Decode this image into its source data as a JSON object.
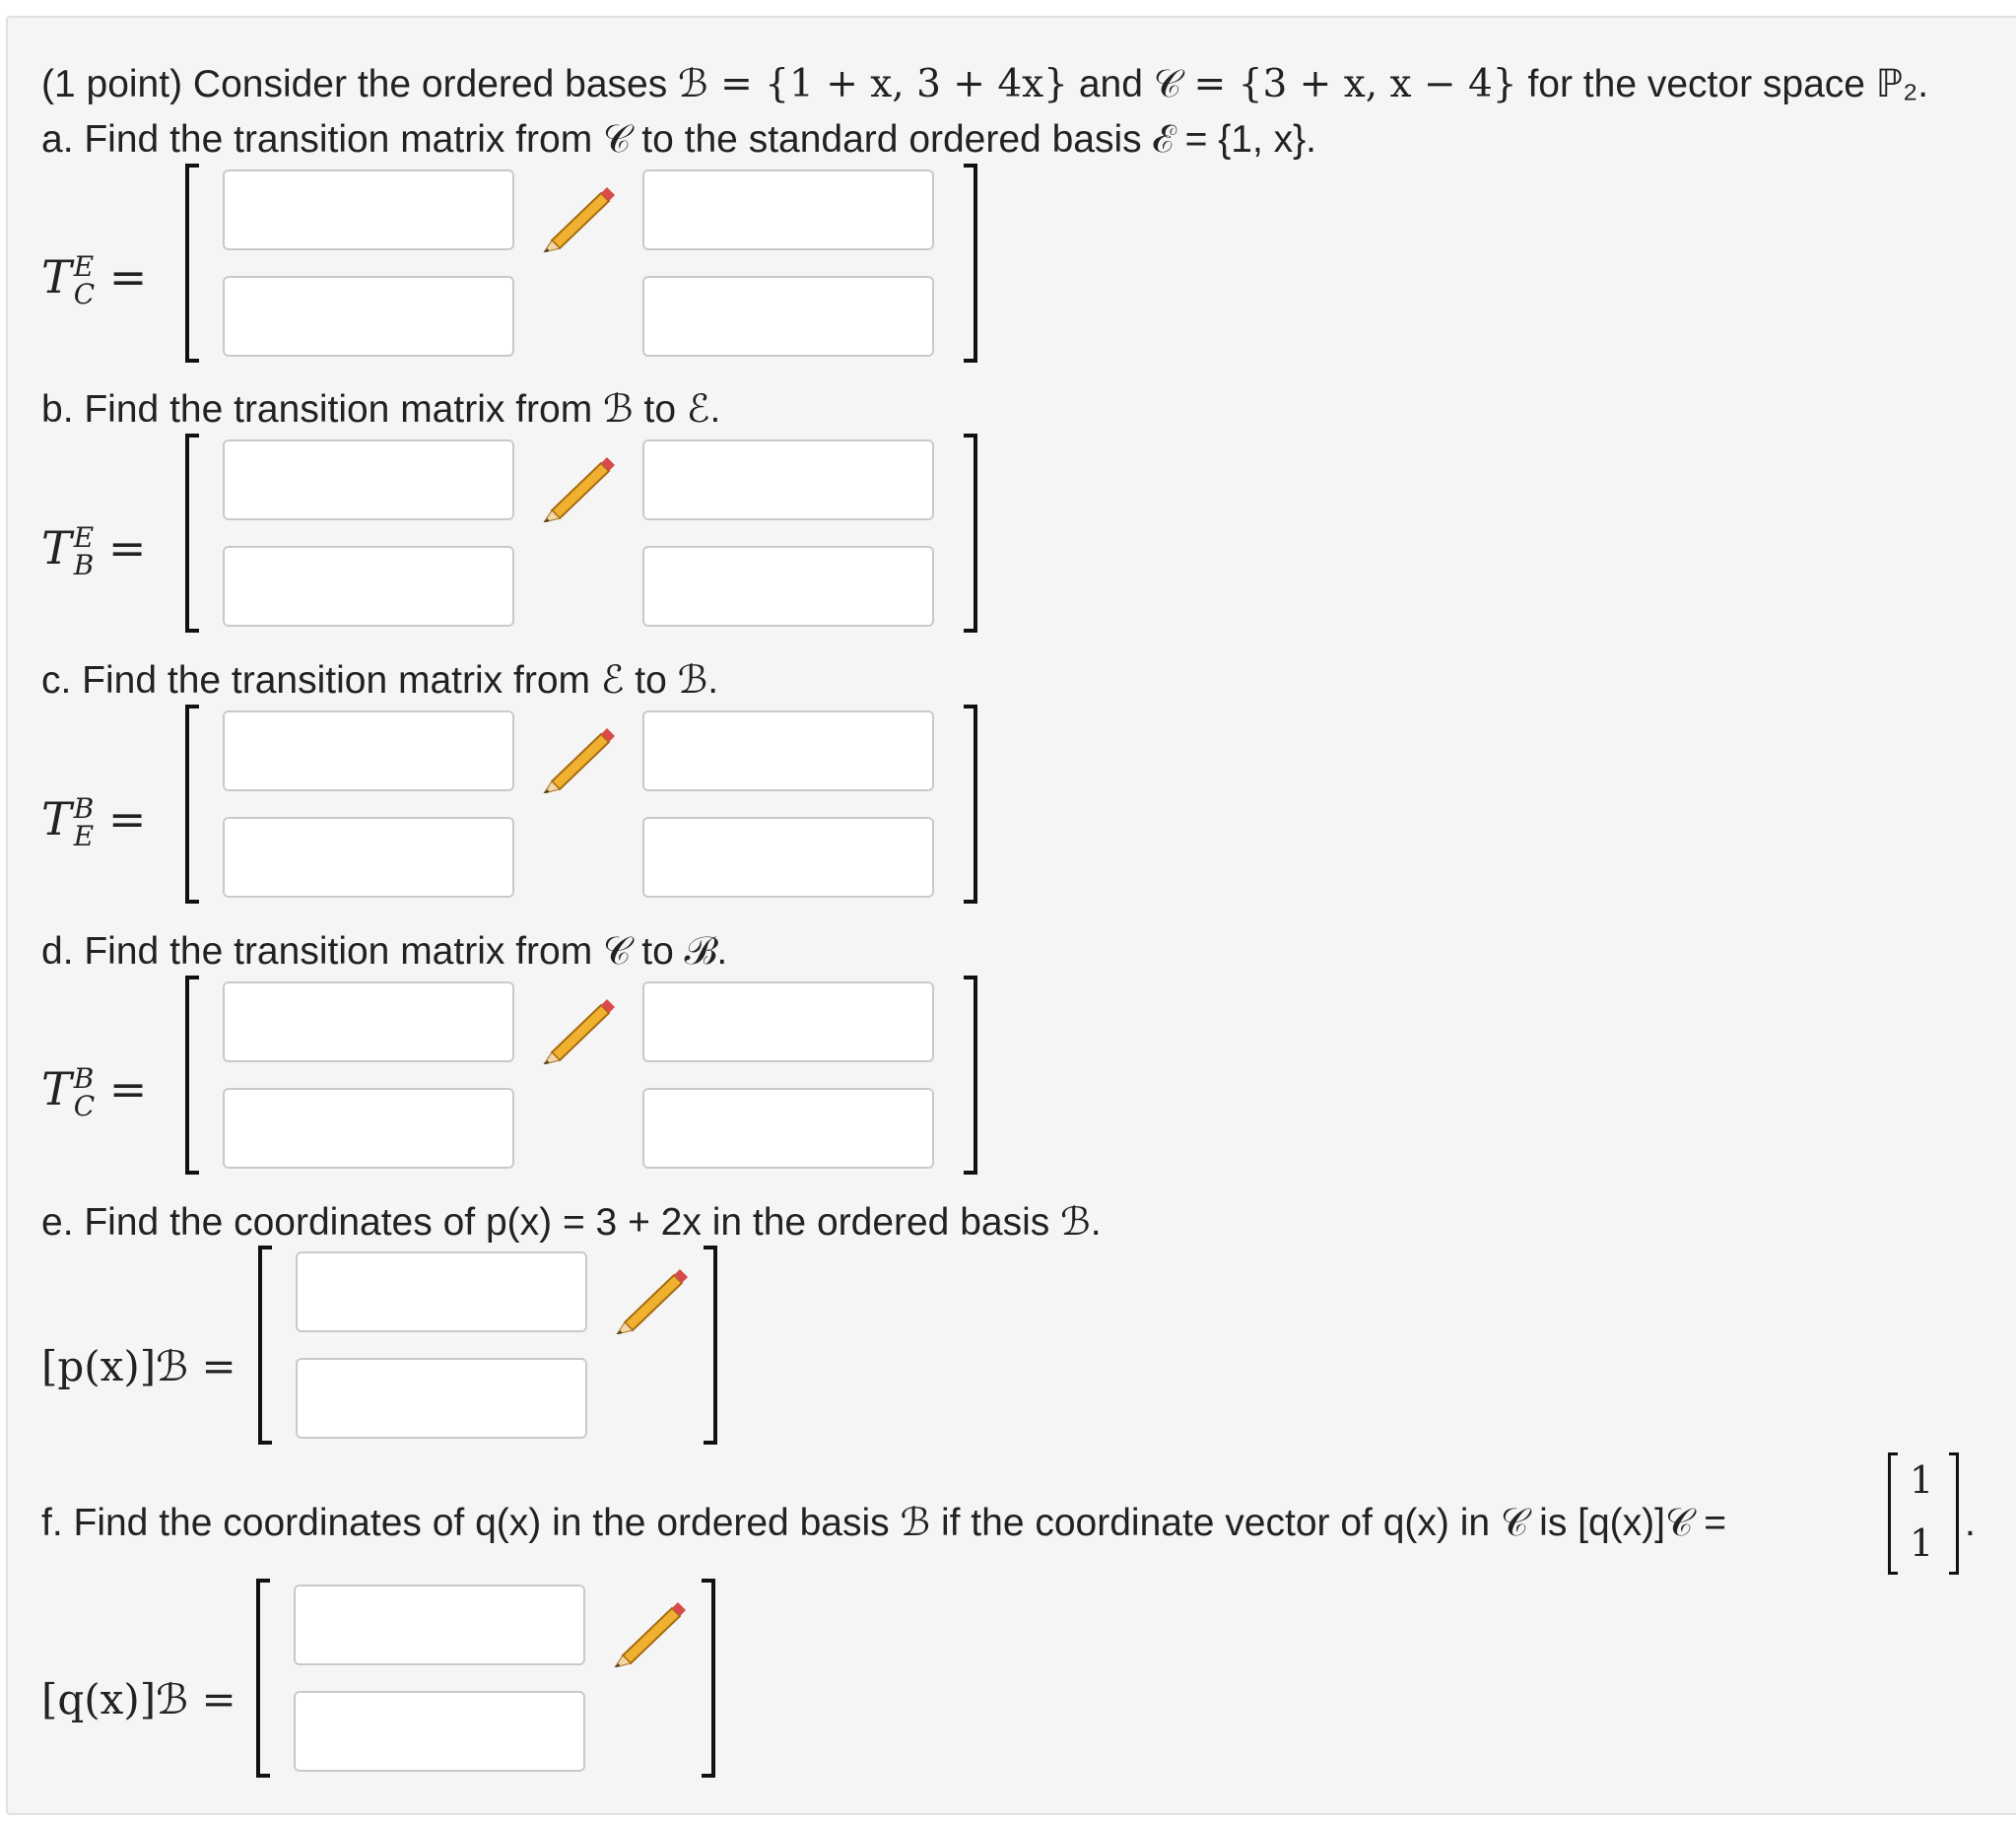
{
  "intro": {
    "prefix": "(1 point) Consider the ordered bases ",
    "b_basis": "ℬ = {1 + x, 3 + 4x}",
    "and": " and ",
    "c_basis": "𝒞 = {3 + x, x − 4}",
    "suffix": " for the vector space ℙ₂."
  },
  "parts": {
    "a": {
      "text": "a. Find the transition matrix from 𝒞 to the standard ordered basis ℰ = {1, x}.",
      "sym": "T",
      "sup": "E",
      "sub": "C"
    },
    "b": {
      "text": "b. Find the transition matrix from ℬ to ℰ.",
      "sym": "T",
      "sup": "E",
      "sub": "B"
    },
    "c": {
      "text": "c. Find the transition matrix from ℰ to ℬ.",
      "sym": "T",
      "sup": "B",
      "sub": "E"
    },
    "d": {
      "text": "d. Find the transition matrix from 𝒞 to ℬ.",
      "sym": "T",
      "sup": "B",
      "sub": "C"
    },
    "e": {
      "text": "e. Find the coordinates of p(x) = 3 + 2x in the ordered basis ℬ.",
      "label": "[p(x)]ℬ ="
    },
    "f": {
      "text": "f. Find the coordinates of q(x) in the ordered basis ℬ if the coordinate vector of q(x) in 𝒞 is [q(x)]𝒞 =",
      "vector_top": "1",
      "vector_bottom": "1",
      "end": ".",
      "label": "[q(x)]ℬ ="
    }
  },
  "equals": "=",
  "answer_values": [
    "",
    "",
    "",
    "",
    "",
    "",
    "",
    "",
    "",
    "",
    "",
    "",
    "",
    "",
    "",
    "",
    "",
    "",
    "",
    ""
  ],
  "icons": {
    "matrix_button": "grid-icon",
    "edit": "pencil-icon"
  }
}
